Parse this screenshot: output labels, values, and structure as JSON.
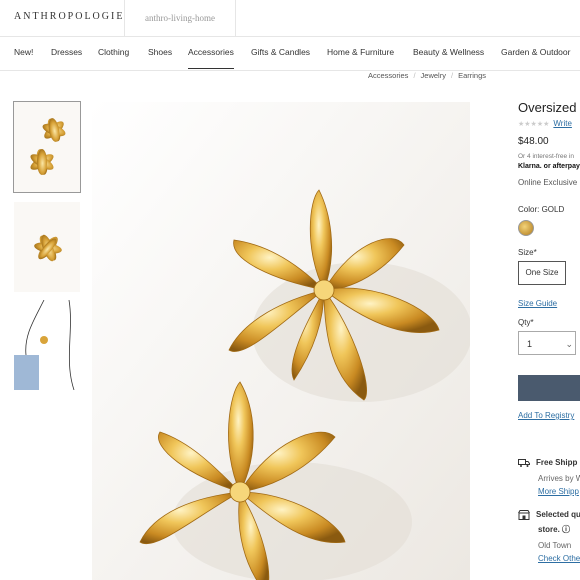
{
  "header": {
    "brand": "ANTHROPOLOGIE",
    "sub_brand": "anthro-living-home"
  },
  "nav": {
    "items": [
      "New!",
      "Dresses",
      "Clothing",
      "Shoes",
      "Accessories",
      "Gifts & Candles",
      "Home & Furniture",
      "Beauty & Wellness",
      "Garden & Outdoor"
    ],
    "active": "Accessories"
  },
  "breadcrumb": [
    "Accessories",
    "Jewelry",
    "Earrings"
  ],
  "product": {
    "title": "Oversized",
    "write_review": "Write",
    "price": "$48.00",
    "installments": "Or 4 interest-free in",
    "pay_options": "Klarna. or afterpay",
    "online_exclusive": "Online Exclusive",
    "color_label": "Color:",
    "color_value": "GOLD",
    "size_label": "Size*",
    "size_value": "One Size",
    "size_guide": "Size Guide",
    "qty_label": "Qty*",
    "qty_value": "1",
    "add_to_registry": "Add To Registry",
    "free_shipping": "Free Shipp",
    "arrives_by": "Arrives by W",
    "more_shipping": "More Shipp",
    "selected_store": "Selected qu",
    "store_suffix": "store.",
    "store_name": "Old Town",
    "check_other": "Check Othe"
  },
  "colors": {
    "accent_link": "#2d6ea3",
    "button": "#4a5a6e",
    "gold": "#d8a53a"
  }
}
